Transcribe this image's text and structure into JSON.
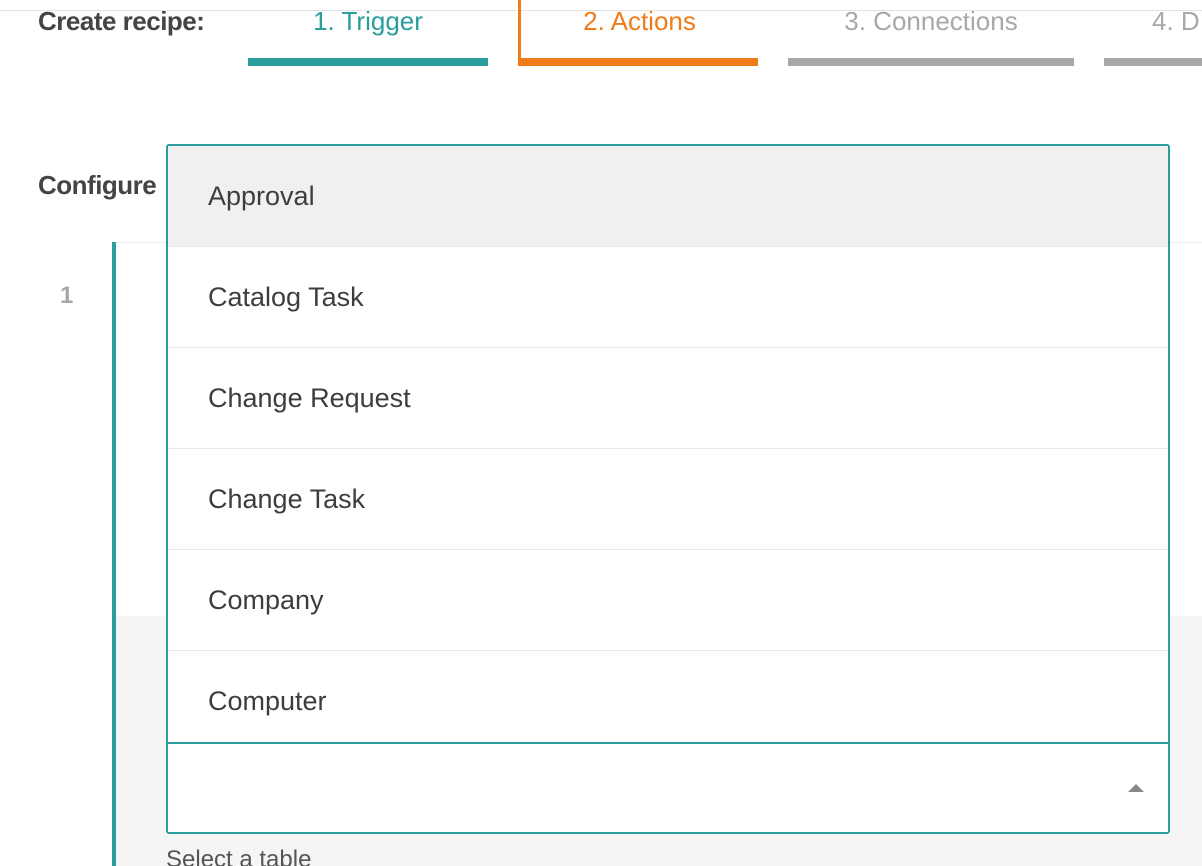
{
  "header": {
    "create_label": "Create recipe:",
    "steps": [
      {
        "label": "1. Trigger",
        "state": "complete",
        "color": "#2a9d9d"
      },
      {
        "label": "2. Actions",
        "state": "active",
        "color": "#f07c18"
      },
      {
        "label": "3. Connections",
        "state": "upcoming",
        "color": "#a8a8a8"
      },
      {
        "label": "4. D",
        "state": "upcoming",
        "color": "#a8a8a8"
      }
    ]
  },
  "main": {
    "configure_label": "Configure",
    "step_number": "1",
    "helper_text": "Select a table"
  },
  "dropdown": {
    "options": [
      {
        "label": "Approval",
        "highlighted": true
      },
      {
        "label": "Catalog Task"
      },
      {
        "label": "Change Request"
      },
      {
        "label": "Change Task"
      },
      {
        "label": "Company"
      },
      {
        "label": "Computer"
      }
    ],
    "value": "",
    "icon": "caret-up-icon"
  },
  "colors": {
    "accent": "#2a9d9d",
    "active_step": "#f07c18",
    "inactive_step": "#a8a8a8"
  }
}
